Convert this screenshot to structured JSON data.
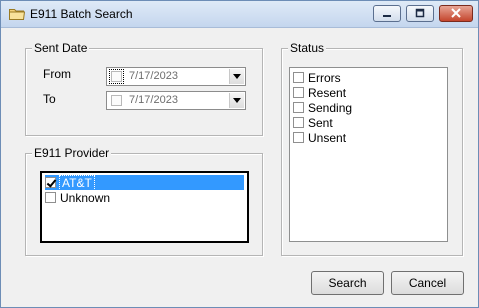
{
  "window": {
    "title": "E911 Batch Search",
    "icon": "folder-icon"
  },
  "sent_date": {
    "legend": "Sent Date",
    "from_label": "From",
    "to_label": "To",
    "from_value": "7/17/2023",
    "to_value": "7/17/2023",
    "from_enabled": false,
    "to_enabled": false
  },
  "provider": {
    "legend": "E911 Provider",
    "items": [
      {
        "label": "AT&T",
        "checked": true,
        "selected": true
      },
      {
        "label": "Unknown",
        "checked": false,
        "selected": false
      }
    ]
  },
  "status": {
    "legend": "Status",
    "items": [
      {
        "label": "Errors",
        "checked": false
      },
      {
        "label": "Resent",
        "checked": false
      },
      {
        "label": "Sending",
        "checked": false
      },
      {
        "label": "Sent",
        "checked": false
      },
      {
        "label": "Unsent",
        "checked": false
      }
    ]
  },
  "buttons": {
    "search": "Search",
    "cancel": "Cancel"
  },
  "colors": {
    "selection": "#3399ff",
    "window_bg": "#f0f0f0",
    "close_button": "#c4452c"
  }
}
